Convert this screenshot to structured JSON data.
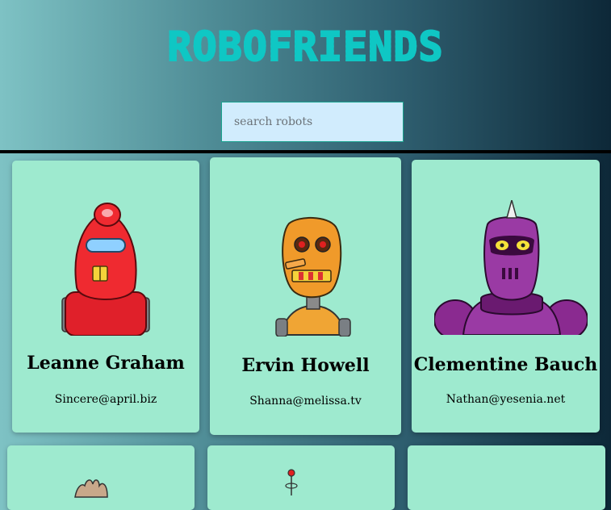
{
  "header": {
    "title": "ROBOFRIENDS"
  },
  "search": {
    "placeholder": "search robots"
  },
  "robots": [
    {
      "name": "Leanne Graham",
      "email": "Sincere@april.biz",
      "avatar": "red-robot-icon"
    },
    {
      "name": "Ervin Howell",
      "email": "Shanna@melissa.tv",
      "avatar": "orange-robot-icon"
    },
    {
      "name": "Clementine Bauch",
      "email": "Nathan@yesenia.net",
      "avatar": "purple-robot-icon"
    }
  ],
  "colors": {
    "card_bg": "#9eeacf",
    "title": "#0fc7c4",
    "search_bg": "#d1ecfd"
  }
}
